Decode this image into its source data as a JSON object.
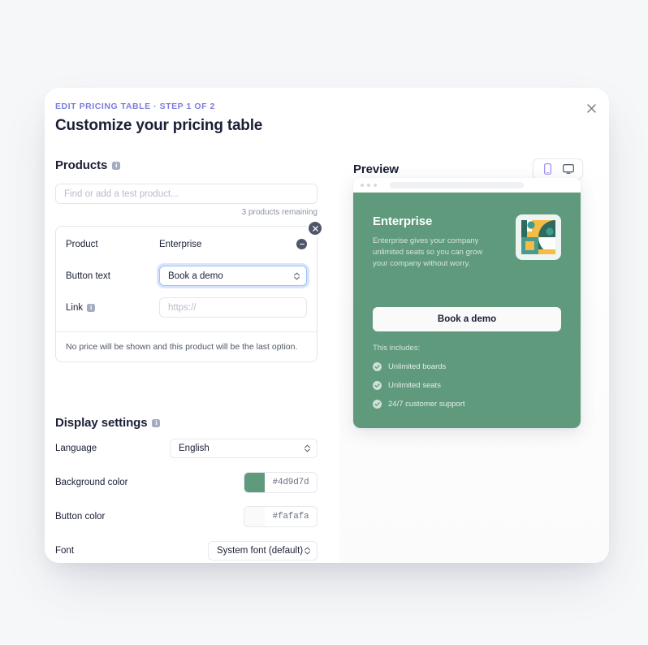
{
  "modal": {
    "eyebrow": "EDIT PRICING TABLE · STEP 1 OF 2",
    "title": "Customize your pricing table",
    "close_icon": "close-icon"
  },
  "products": {
    "heading": "Products",
    "info_icon": "info-icon",
    "search_placeholder": "Find or add a test product...",
    "search_value": "",
    "remaining": "3 products remaining",
    "card": {
      "remove_badge_icon": "close-circle-icon",
      "rows": [
        {
          "label": "Product",
          "value": "Enterprise",
          "type": "value",
          "minus_icon": "minus-circle-icon"
        },
        {
          "label": "Button text",
          "value": "Book a demo",
          "type": "select"
        },
        {
          "label": "Link",
          "value": "",
          "placeholder": "https://",
          "type": "input",
          "info_icon": "info-icon"
        }
      ],
      "footnote": "No price will be shown and this product will be the last option."
    }
  },
  "display_settings": {
    "heading": "Display settings",
    "info_icon": "info-icon",
    "language": {
      "label": "Language",
      "value": "English"
    },
    "background_color": {
      "label": "Background color",
      "value": "#4d9d7d",
      "swatch": "#5f9a7d"
    },
    "button_color": {
      "label": "Button color",
      "value": "#fafafa",
      "swatch": "#fafafa"
    },
    "font": {
      "label": "Font",
      "value": "System font (default)"
    }
  },
  "preview": {
    "heading": "Preview",
    "device_toggle": {
      "mobile": {
        "icon": "mobile-icon",
        "selected": true
      },
      "desktop": {
        "icon": "monitor-icon",
        "selected": false
      }
    },
    "card": {
      "background_color": "#5f9a7d",
      "title": "Enterprise",
      "description": "Enterprise gives your company unlimited seats so you can grow your company without worry.",
      "product_image_icon": "abstract-product-image",
      "cta_label": "Book a demo",
      "includes_label": "This includes:",
      "features": [
        "Unlimited boards",
        "Unlimited seats",
        "24/7 customer support"
      ],
      "feature_icon": "check-circle-icon"
    }
  }
}
